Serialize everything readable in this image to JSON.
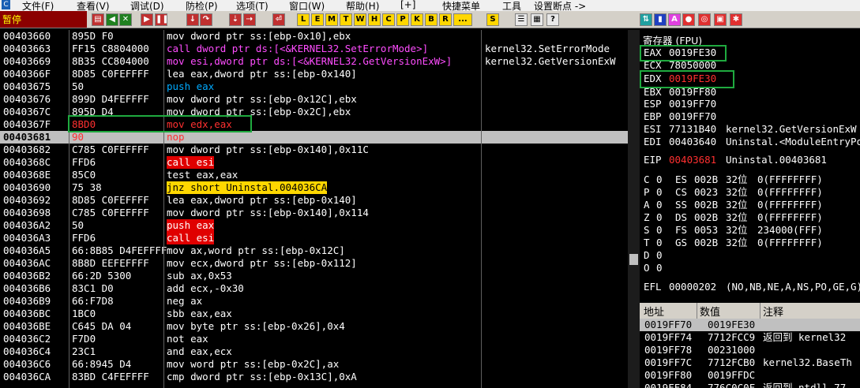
{
  "menubar": {
    "items": [
      "文件(F)",
      "查看(V)",
      "调试(D)",
      "防检(P)",
      "选项(T)",
      "窗口(W)",
      "帮助(H)",
      "[+]",
      "快捷菜单",
      "工具",
      "设置断点 ->"
    ]
  },
  "toolbar": {
    "status": "暂停",
    "letter_buttons": [
      "L",
      "E",
      "M",
      "T",
      "W",
      "H",
      "C",
      "P",
      "K",
      "B",
      "R",
      "...",
      "S"
    ]
  },
  "code": {
    "rows": [
      {
        "addr": "00403660",
        "hex": "895D F0",
        "dis": "mov dword ptr ss:[ebp-0x10],ebx",
        "cmt": ""
      },
      {
        "addr": "00403663",
        "hex": "FF15 C8804000",
        "dis": "call dword ptr ds:[<&KERNEL32.SetErrorMode>]",
        "cmt": "kernel32.SetErrorMode"
      },
      {
        "addr": "00403669",
        "hex": "8B35 CC804000",
        "dis": "mov esi,dword ptr ds:[<&KERNEL32.GetVersionExW>]",
        "cmt": "kernel32.GetVersionExW"
      },
      {
        "addr": "0040366F",
        "hex": "8D85 C0FEFFFF",
        "dis": "lea eax,dword ptr ss:[ebp-0x140]",
        "cmt": ""
      },
      {
        "addr": "00403675",
        "hex": "50",
        "dis": "push eax",
        "cmt": ""
      },
      {
        "addr": "00403676",
        "hex": "899D D4FEFFFF",
        "dis": "mov dword ptr ss:[ebp-0x12C],ebx",
        "cmt": ""
      },
      {
        "addr": "0040367C",
        "hex": "895D D4",
        "dis": "mov dword ptr ss:[ebp-0x2C],ebx",
        "cmt": ""
      },
      {
        "addr": "0040367F",
        "hex": "8BD0",
        "dis": "mov edx,eax",
        "cmt": ""
      },
      {
        "addr": "00403681",
        "hex": "90",
        "dis": "nop",
        "cmt": ""
      },
      {
        "addr": "00403682",
        "hex": "C785 C0FEFFFF",
        "dis": "mov dword ptr ss:[ebp-0x140],0x11C",
        "cmt": ""
      },
      {
        "addr": "0040368C",
        "hex": "FFD6",
        "dis": "call esi",
        "cmt": ""
      },
      {
        "addr": "0040368E",
        "hex": "85C0",
        "dis": "test eax,eax",
        "cmt": ""
      },
      {
        "addr": "00403690",
        "hex": "75 38",
        "dis": "jnz short Uninstal.004036CA",
        "cmt": ""
      },
      {
        "addr": "00403692",
        "hex": "8D85 C0FEFFFF",
        "dis": "lea eax,dword ptr ss:[ebp-0x140]",
        "cmt": ""
      },
      {
        "addr": "00403698",
        "hex": "C785 C0FEFFFF",
        "dis": "mov dword ptr ss:[ebp-0x140],0x114",
        "cmt": ""
      },
      {
        "addr": "004036A2",
        "hex": "50",
        "dis": "push eax",
        "cmt": ""
      },
      {
        "addr": "004036A3",
        "hex": "FFD6",
        "dis": "call esi",
        "cmt": ""
      },
      {
        "addr": "004036A5",
        "hex": "66:8B85 D4FEFFFF",
        "dis": "mov ax,word ptr ss:[ebp-0x12C]",
        "cmt": ""
      },
      {
        "addr": "004036AC",
        "hex": "8B8D EEFEFFFF",
        "dis": "mov ecx,dword ptr ss:[ebp-0x112]",
        "cmt": ""
      },
      {
        "addr": "004036B2",
        "hex": "66:2D 5300",
        "dis": "sub ax,0x53",
        "cmt": ""
      },
      {
        "addr": "004036B6",
        "hex": "83C1 D0",
        "dis": "add ecx,-0x30",
        "cmt": ""
      },
      {
        "addr": "004036B9",
        "hex": "66:F7D8",
        "dis": "neg ax",
        "cmt": ""
      },
      {
        "addr": "004036BC",
        "hex": "1BC0",
        "dis": "sbb eax,eax",
        "cmt": ""
      },
      {
        "addr": "004036BE",
        "hex": "C645 DA 04",
        "dis": "mov byte ptr ss:[ebp-0x26],0x4",
        "cmt": ""
      },
      {
        "addr": "004036C2",
        "hex": "F7D0",
        "dis": "not eax",
        "cmt": ""
      },
      {
        "addr": "004036C4",
        "hex": "23C1",
        "dis": "and eax,ecx",
        "cmt": ""
      },
      {
        "addr": "004036C6",
        "hex": "66:8945 D4",
        "dis": "mov word ptr ss:[ebp-0x2C],ax",
        "cmt": ""
      },
      {
        "addr": "004036CA",
        "hex": "83BD C4FEFFFF",
        "dis": "cmp dword ptr ss:[ebp-0x13C],0xA",
        "cmt": ""
      }
    ]
  },
  "registers": {
    "title": "寄存器 (FPU)",
    "rows": [
      {
        "name": "EAX",
        "value": "0019FE30",
        "info": ""
      },
      {
        "name": "ECX",
        "value": "78050000",
        "info": ""
      },
      {
        "name": "EDX",
        "value": "0019FE30",
        "info": ""
      },
      {
        "name": "EBX",
        "value": "0019FF80",
        "info": ""
      },
      {
        "name": "ESP",
        "value": "0019FF70",
        "info": ""
      },
      {
        "name": "EBP",
        "value": "0019FF70",
        "info": ""
      },
      {
        "name": "ESI",
        "value": "77131B40",
        "info": "kernel32.GetVersionExW"
      },
      {
        "name": "EDI",
        "value": "00403640",
        "info": "Uninstal.<ModuleEntryPoint>"
      }
    ],
    "eip": {
      "name": "EIP",
      "value": "00403681",
      "info": "Uninstal.00403681"
    },
    "flags": [
      {
        "f": "C",
        "v": "0",
        "seg": "ES",
        "sel": "002B",
        "bits": "32位",
        "info": "0(FFFFFFFF)"
      },
      {
        "f": "P",
        "v": "0",
        "seg": "CS",
        "sel": "0023",
        "bits": "32位",
        "info": "0(FFFFFFFF)"
      },
      {
        "f": "A",
        "v": "0",
        "seg": "SS",
        "sel": "002B",
        "bits": "32位",
        "info": "0(FFFFFFFF)"
      },
      {
        "f": "Z",
        "v": "0",
        "seg": "DS",
        "sel": "002B",
        "bits": "32位",
        "info": "0(FFFFFFFF)"
      },
      {
        "f": "S",
        "v": "0",
        "seg": "FS",
        "sel": "0053",
        "bits": "32位",
        "info": "234000(FFF)"
      },
      {
        "f": "T",
        "v": "0",
        "seg": "GS",
        "sel": "002B",
        "bits": "32位",
        "info": "0(FFFFFFFF)"
      },
      {
        "f": "D",
        "v": "0",
        "seg": "",
        "sel": "",
        "bits": "",
        "info": ""
      },
      {
        "f": "O",
        "v": "0",
        "seg": "",
        "sel": "",
        "bits": "",
        "info": ""
      }
    ],
    "efl": {
      "name": "EFL",
      "value": "00000202",
      "info": "(NO,NB,NE,A,NS,PO,GE,G)"
    }
  },
  "stack": {
    "headers": [
      "地址",
      "数值",
      "注释"
    ],
    "rows": [
      {
        "addr": "0019FF70",
        "val": "0019FE30",
        "cmt": ""
      },
      {
        "addr": "0019FF74",
        "val": "7712FCC9",
        "cmt": "返回到 kernel32"
      },
      {
        "addr": "0019FF78",
        "val": "00231000",
        "cmt": ""
      },
      {
        "addr": "0019FF7C",
        "val": "7712FCB0",
        "cmt": "kernel32.BaseTh"
      },
      {
        "addr": "0019FF80",
        "val": "0019FFDC",
        "cmt": ""
      },
      {
        "addr": "0019FF84",
        "val": "776C0C0F",
        "cmt": "返回到 ntdll.77"
      }
    ]
  },
  "colors": {
    "highlight_box": "#1faa3f",
    "selection": "#c0c0c0",
    "call_bg": "#e00000",
    "jump_bg": "#ffd700"
  }
}
